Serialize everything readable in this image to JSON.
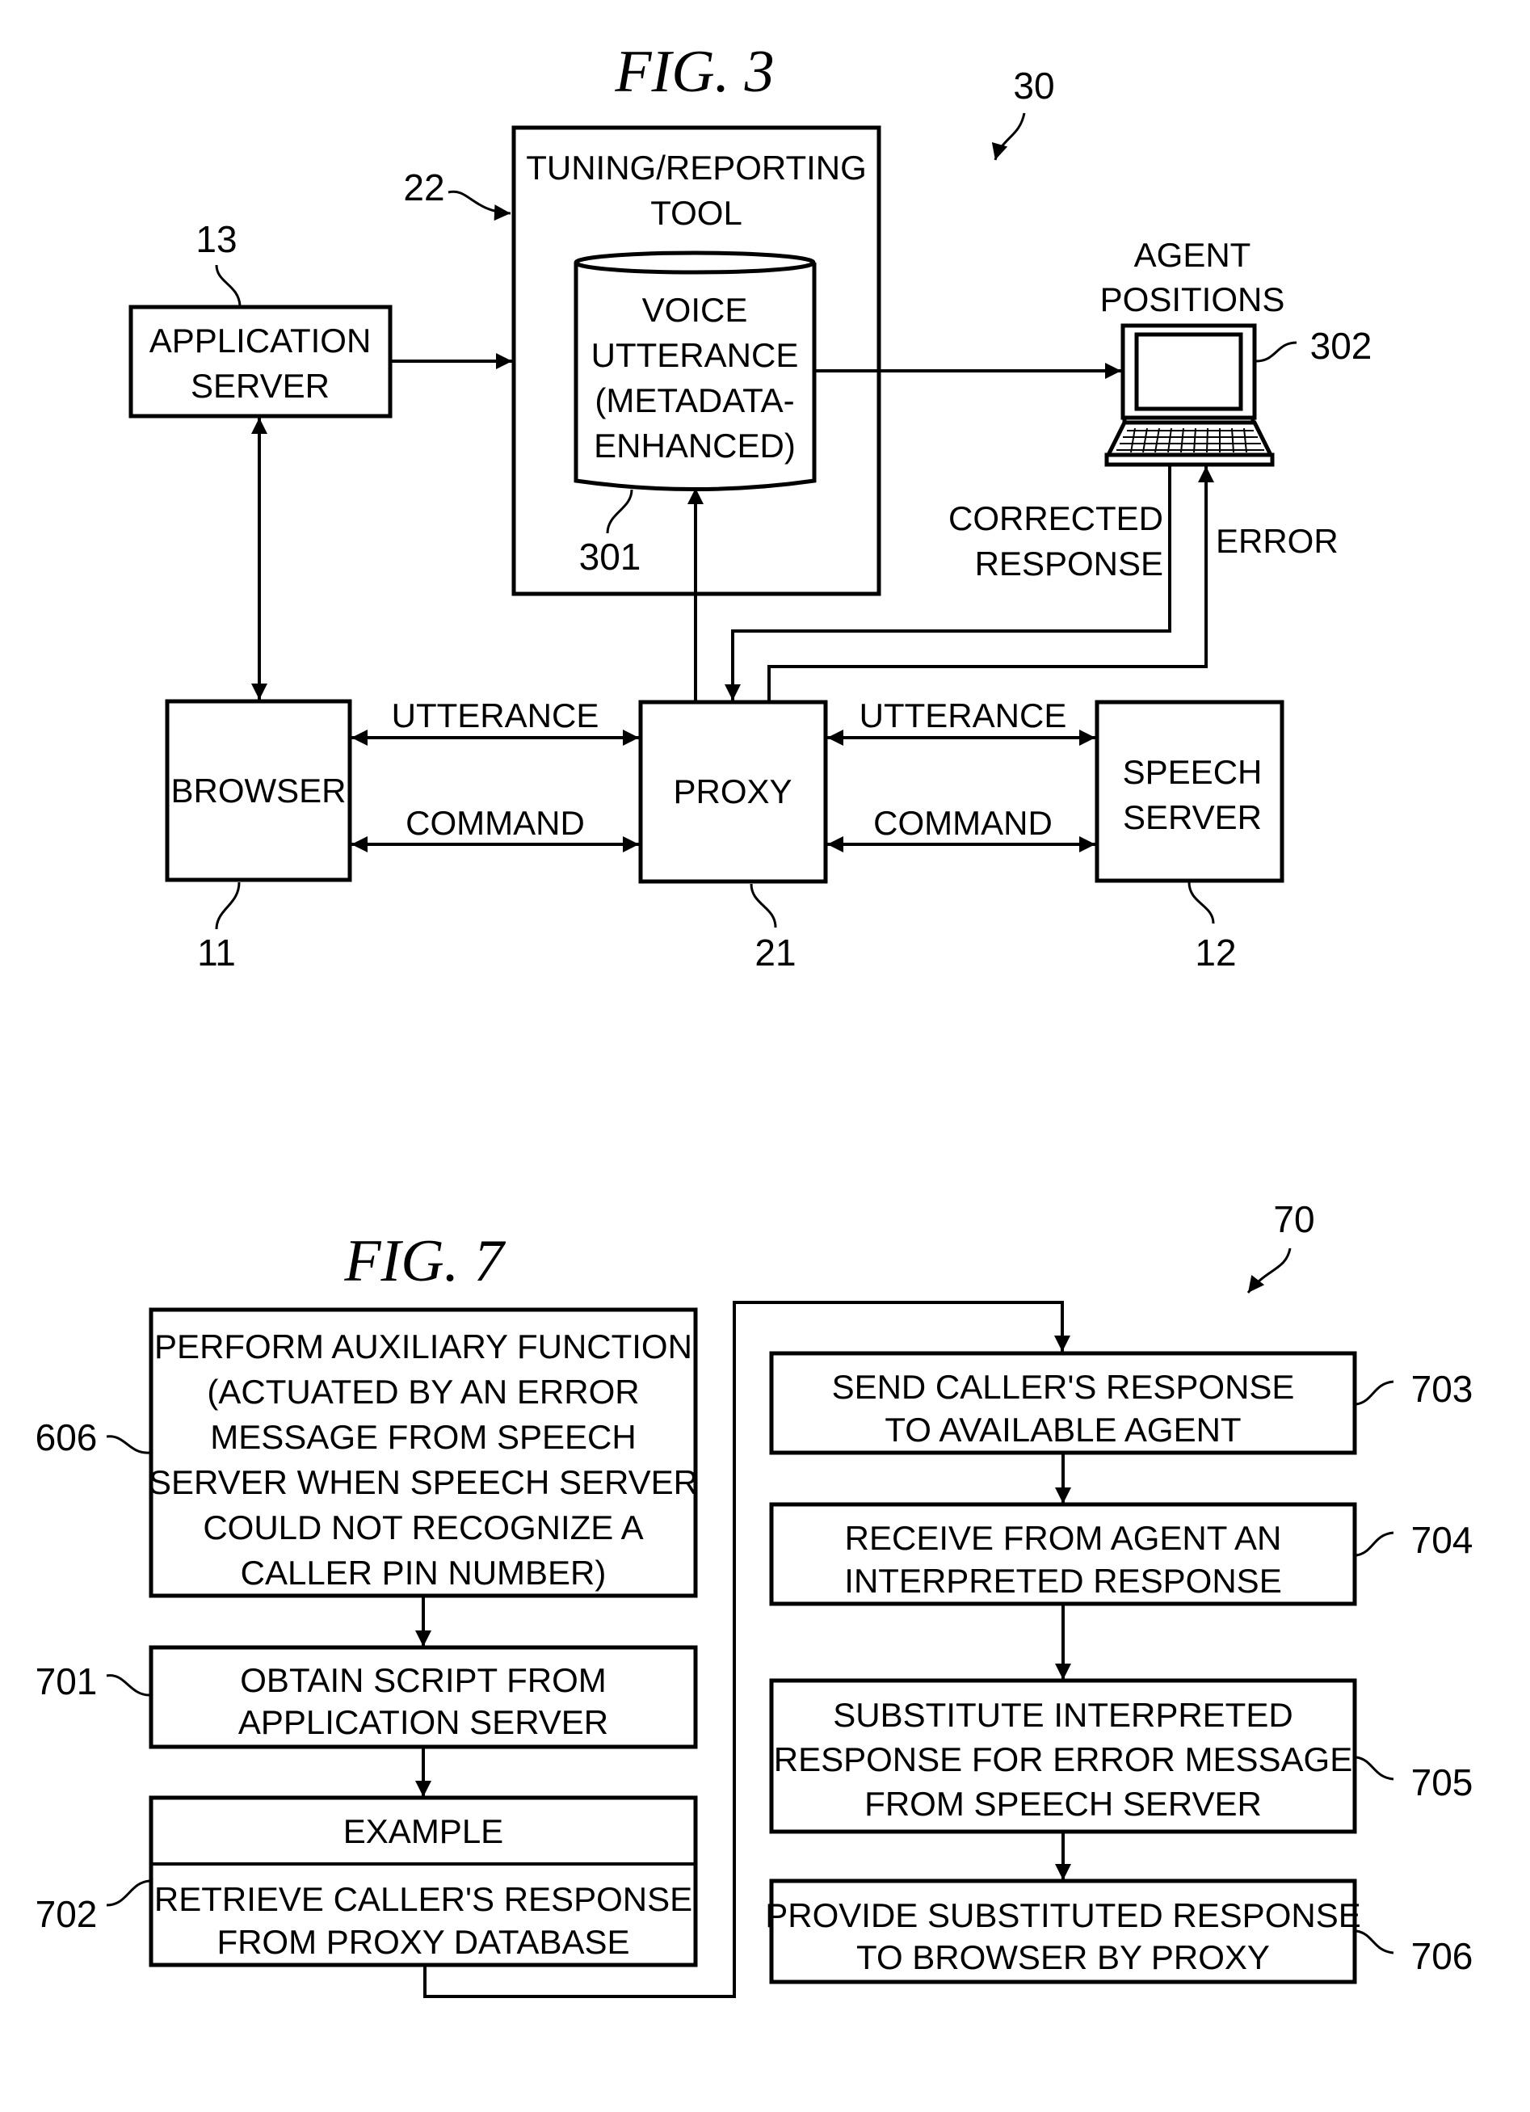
{
  "fig3": {
    "title": "FIG. 3",
    "ref_system": "30",
    "tool": {
      "ref": "22",
      "lines": [
        "TUNING/REPORTING",
        "TOOL"
      ]
    },
    "database": {
      "ref": "301",
      "lines": [
        "VOICE",
        "UTTERANCE",
        "(METADATA-",
        "ENHANCED)"
      ]
    },
    "app_server": {
      "ref": "13",
      "lines": [
        "APPLICATION",
        "SERVER"
      ]
    },
    "agent": {
      "ref": "302",
      "lines": [
        "AGENT",
        "POSITIONS"
      ],
      "icon": "laptop-icon"
    },
    "browser": {
      "ref": "11",
      "label": "BROWSER"
    },
    "proxy": {
      "ref": "21",
      "label": "PROXY"
    },
    "speech_server": {
      "ref": "12",
      "lines": [
        "SPEECH",
        "SERVER"
      ]
    },
    "links": {
      "utterance_left": "UTTERANCE",
      "command_left": "COMMAND",
      "utterance_right": "UTTERANCE",
      "command_right": "COMMAND",
      "corrected": [
        "CORRECTED",
        "RESPONSE"
      ],
      "error": "ERROR"
    }
  },
  "fig7": {
    "title": "FIG. 7",
    "ref_flow": "70",
    "steps": [
      {
        "ref": "606",
        "lines": [
          "PERFORM AUXILIARY FUNCTION",
          "(ACTUATED BY AN ERROR",
          "MESSAGE FROM SPEECH",
          "SERVER WHEN SPEECH SERVER",
          "COULD NOT RECOGNIZE A",
          "CALLER PIN NUMBER)"
        ]
      },
      {
        "ref": "701",
        "lines": [
          "OBTAIN SCRIPT FROM",
          "APPLICATION SERVER"
        ]
      },
      {
        "ref": "702",
        "header": "EXAMPLE",
        "lines": [
          "RETRIEVE CALLER'S RESPONSE",
          "FROM PROXY DATABASE"
        ]
      },
      {
        "ref": "703",
        "lines": [
          "SEND CALLER'S RESPONSE",
          "TO AVAILABLE AGENT"
        ]
      },
      {
        "ref": "704",
        "lines": [
          "RECEIVE FROM AGENT AN",
          "INTERPRETED RESPONSE"
        ]
      },
      {
        "ref": "705",
        "lines": [
          "SUBSTITUTE INTERPRETED",
          "RESPONSE FOR ERROR MESSAGE",
          "FROM SPEECH SERVER"
        ]
      },
      {
        "ref": "706",
        "lines": [
          "PROVIDE SUBSTITUTED RESPONSE",
          "TO BROWSER BY PROXY"
        ]
      }
    ]
  }
}
